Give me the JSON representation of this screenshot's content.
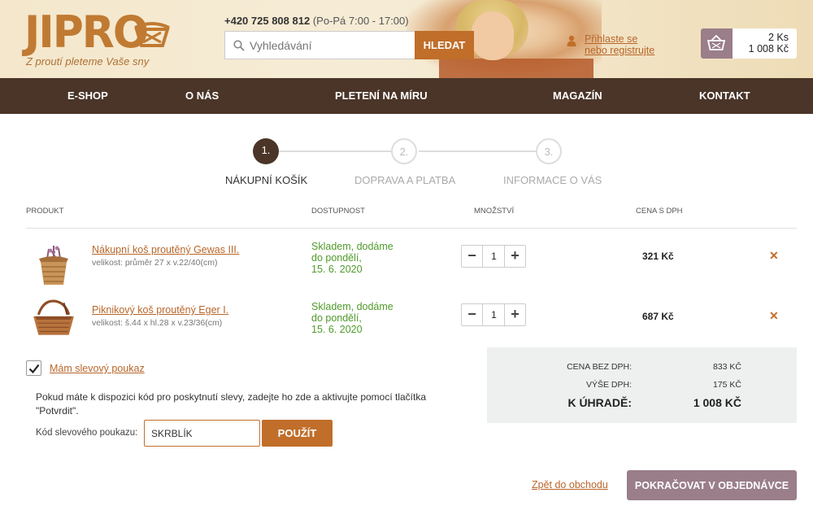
{
  "brand": {
    "logo_text": "JIPRO",
    "tagline": "Z proutí pleteme Vaše sny"
  },
  "header": {
    "phone": "+420 725 808 812",
    "hours": "(Po-Pá 7:00 - 17:00)",
    "search_placeholder": "Vyhledávání",
    "search_button": "HLEDAT",
    "login_line1": "Přihlaste se",
    "login_line2": "nebo registrujte",
    "cart_count": "2 Ks",
    "cart_total": "1 008 Kč"
  },
  "nav": {
    "items": [
      {
        "label": "E-SHOP"
      },
      {
        "label": "O NÁS"
      },
      {
        "label": "PLETENÍ NA MÍRU"
      },
      {
        "label": "MAGAZÍN"
      },
      {
        "label": "KONTAKT"
      }
    ]
  },
  "steps": [
    {
      "number": "1.",
      "label": "NÁKUPNÍ KOŠÍK",
      "active": true
    },
    {
      "number": "2.",
      "label": "DOPRAVA A PLATBA",
      "active": false
    },
    {
      "number": "3.",
      "label": "INFORMACE O VÁS",
      "active": false
    }
  ],
  "table": {
    "headers": {
      "product": "PRODUKT",
      "availability": "DOSTUPNOST",
      "quantity": "MNOŽSTVÍ",
      "price": "CENA S DPH"
    },
    "rows": [
      {
        "name": "Nákupní koš proutěný Gewas III.",
        "variant": "velikost: průměr 27 x v.22/40(cm)",
        "avail_1": "Skladem, dodáme",
        "avail_2": "do pondělí,",
        "avail_3": "15. 6. 2020",
        "qty": "1",
        "price": "321 Kč"
      },
      {
        "name": "Piknikový koš proutěný Eger I.",
        "variant": "velikost: š.44 x hl.28 x v.23/36(cm)",
        "avail_1": "Skladem, dodáme",
        "avail_2": "do pondělí,",
        "avail_3": "15. 6. 2020",
        "qty": "1",
        "price": "687 Kč"
      }
    ]
  },
  "discount": {
    "checkbox_label": "Mám slevový poukaz",
    "checked": true,
    "help_text": "Pokud máte k dispozici kód pro poskytnutí slevy, zadejte ho zde a aktivujte pomocí tlačítka \"Potvrdit\".",
    "code_label": "Kód slevového poukazu:",
    "code_value": "SKRBLÍK",
    "apply_button": "POUŽÍT"
  },
  "summary": {
    "without_vat_label": "CENA BEZ DPH:",
    "without_vat_value": "833 KČ",
    "vat_label": "VÝŠE DPH:",
    "vat_value": "175 KČ",
    "total_label": "K ÚHRADĚ:",
    "total_value": "1 008 KČ"
  },
  "actions": {
    "back": "Zpět do obchodu",
    "continue": "POKRAČOVAT V OBJEDNÁVCE"
  },
  "colors": {
    "accent": "#c06e2a",
    "nav_bg": "#4a3528",
    "button_muted": "#9a7e8a",
    "in_stock": "#4f9a2a"
  }
}
